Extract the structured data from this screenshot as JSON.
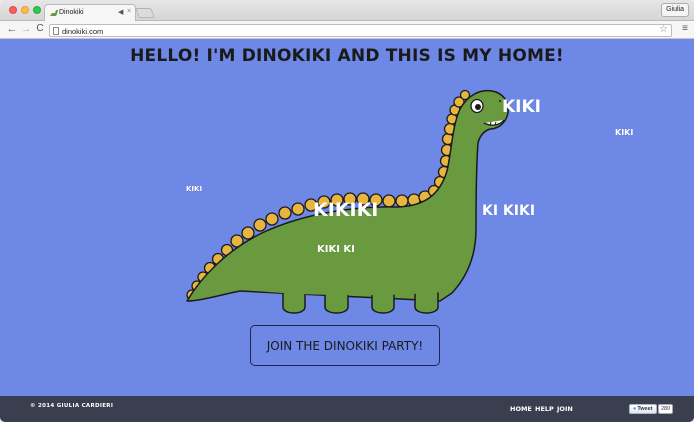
{
  "browser": {
    "tab_title": "Dinokiki",
    "tab_close": "×",
    "tab_speaker": "◀",
    "profile_name": "Giulia",
    "url": "dinokiki.com",
    "nav_back": "←",
    "nav_forward": "→",
    "nav_reload": "C",
    "star": "☆",
    "menu": "≡"
  },
  "page": {
    "headline": "HELLO! I'M DINOKIKI AND THIS IS MY HOME!",
    "kiki_words": [
      {
        "text": "KIKI"
      },
      {
        "text": "KIKI"
      },
      {
        "text": "KIKI"
      },
      {
        "text": "KIKIKI"
      },
      {
        "text": "KI KIKI"
      },
      {
        "text": "KIKI KI"
      }
    ],
    "join_button": "JOIN THE DINOKIKI PARTY!"
  },
  "footer": {
    "copyright": "© 2014 GIULIA CARDIERI",
    "links": [
      "HOME",
      "HELP",
      "JOIN"
    ],
    "tweet_label": "Tweet",
    "tweet_count": "280"
  },
  "colors": {
    "page_bg": "#6e88e6",
    "dino_body": "#6a9a3f",
    "dino_spikes": "#e8b640",
    "footer_bg": "#3a3f4f"
  }
}
